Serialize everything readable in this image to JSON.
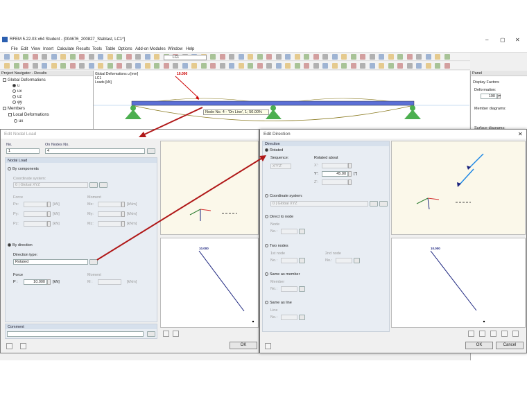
{
  "window": {
    "title": "RFEM 5.22.03 x64 Student - [004676_200827_Stablast, LC1*]"
  },
  "menu": [
    "File",
    "Edit",
    "View",
    "Insert",
    "Calculate",
    "Results",
    "Tools",
    "Table",
    "Options",
    "Add-on Modules",
    "Window",
    "Help"
  ],
  "toolbar": {
    "load_case": "LC1"
  },
  "navigator": {
    "title": "Project Navigator - Results",
    "items": [
      {
        "label": "Global Deformations"
      },
      {
        "label": "u"
      },
      {
        "label": "ux"
      },
      {
        "label": "uz"
      },
      {
        "label": "φy"
      },
      {
        "label": "Members"
      },
      {
        "label": "Local Deformations"
      },
      {
        "label": "ux"
      }
    ]
  },
  "view": {
    "info": [
      "Global Deformations u [mm]",
      "LC1",
      "Loads [kN]"
    ],
    "load_value": "10.000",
    "tooltip": "Node No. 4 - 'On Line', 1; 50.00%"
  },
  "panel": {
    "title": "Panel",
    "display_factors": "Display Factors",
    "deformation_label": "Deformation:",
    "deformation_value": "190",
    "member_diagrams": "Member diagrams:",
    "surface_diagrams": "Surface diagrams:"
  },
  "nodal_load": {
    "title": "Edit Nodal Load",
    "no_label": "No.",
    "no_value": "1",
    "nodes_label": "On Nodes No.",
    "nodes_value": "4",
    "group": "Nodal Load",
    "by_components": "By components",
    "coord_label": "Coordinate system:",
    "coord_value": "0 | Global XYZ",
    "force_label": "Force",
    "moment_label": "Moment",
    "forces": [
      {
        "l": "Px:",
        "u": "[kN]"
      },
      {
        "l": "Py:",
        "u": "[kN]"
      },
      {
        "l": "Pz:",
        "u": "[kN]"
      }
    ],
    "moments": [
      {
        "l": "Mx:",
        "u": "[kNm]"
      },
      {
        "l": "My:",
        "u": "[kNm]"
      },
      {
        "l": "Mz:",
        "u": "[kNm]"
      }
    ],
    "by_direction": "By direction",
    "dir_type_label": "Direction type:",
    "dir_type_value": "Rotated",
    "force2": "Force",
    "moment2": "Moment",
    "p_label": "P :",
    "p_value": "10.000",
    "p_unit": "[kN]",
    "m_label": "M :",
    "m_unit": "[kNm]",
    "comment": "Comment",
    "ok": "OK",
    "preview_load": "10.000"
  },
  "direction": {
    "title": "Edit Direction",
    "group": "Direction",
    "rotated": "Rotated",
    "sequence": "Sequence:",
    "sequence_value": "X'Y'Z'",
    "rotated_about": "Rotated about",
    "x_label": "X':",
    "y_label": "Y':",
    "z_label": "Z':",
    "y_value": "45.00",
    "angle_unit": "[°]",
    "coord_system": "Coordinate system:",
    "coord_value": "0 | Global XYZ",
    "direct_to_node": "Direct to node",
    "node_label": "Node",
    "no_label": "No.:",
    "two_nodes": "Two nodes",
    "first_node": "1st node",
    "second_node": "2nd node",
    "same_member": "Same as member",
    "member_label": "Member",
    "same_line": "Same as line",
    "line_label": "Line",
    "ok": "OK",
    "cancel": "Cancel",
    "preview_load": "10.000"
  },
  "colors": {
    "arrow": "#b01818",
    "beam": "#5b6fd6",
    "support": "#4caf50",
    "load": "#1a237e",
    "axis_x": "#d32f2f",
    "axis_y": "#2e7d32",
    "axis_z": "#1a237e"
  }
}
